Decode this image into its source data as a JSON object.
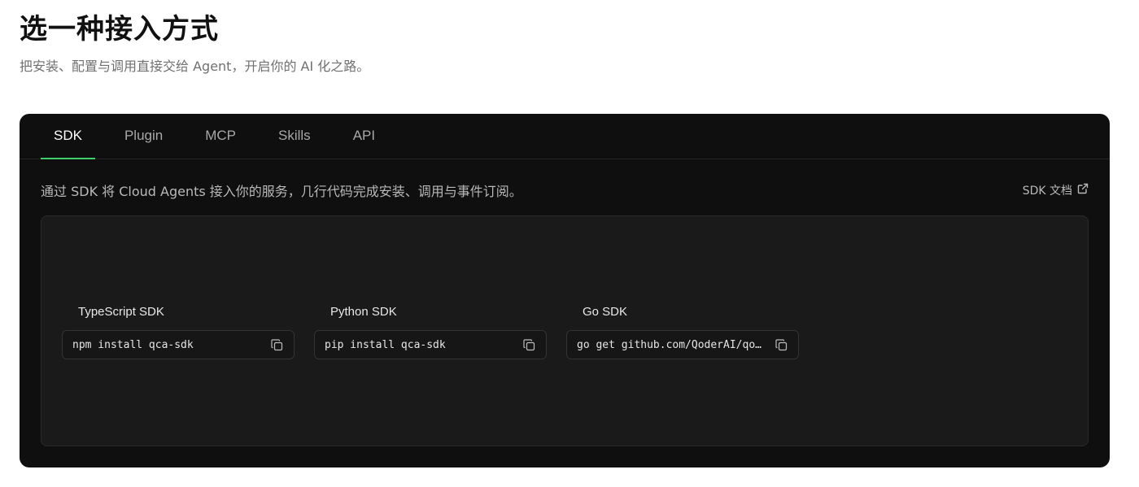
{
  "header": {
    "title": "选一种接入方式",
    "subtitle": "把安装、配置与调用直接交给 Agent，开启你的 AI 化之路。"
  },
  "tabs": [
    {
      "label": "SDK",
      "active": true
    },
    {
      "label": "Plugin",
      "active": false
    },
    {
      "label": "MCP",
      "active": false
    },
    {
      "label": "Skills",
      "active": false
    },
    {
      "label": "API",
      "active": false
    }
  ],
  "content": {
    "description": "通过 SDK 将 Cloud Agents 接入你的服务，几行代码完成安装、调用与事件订阅。",
    "doc_link": "SDK 文档",
    "doc_link_icon": "external-link-icon",
    "sdks": [
      {
        "title": "TypeScript SDK",
        "command": "npm install qca-sdk",
        "icon": "copy-icon"
      },
      {
        "title": "Python SDK",
        "command": "pip install qca-sdk",
        "icon": "copy-icon"
      },
      {
        "title": "Go SDK",
        "command": "go get github.com/QoderAI/qod…",
        "icon": "copy-icon"
      }
    ]
  },
  "colors": {
    "panel_bg": "#0f0f0f",
    "inner_bg": "#1a1a1a",
    "accent": "#3ecf6b"
  }
}
